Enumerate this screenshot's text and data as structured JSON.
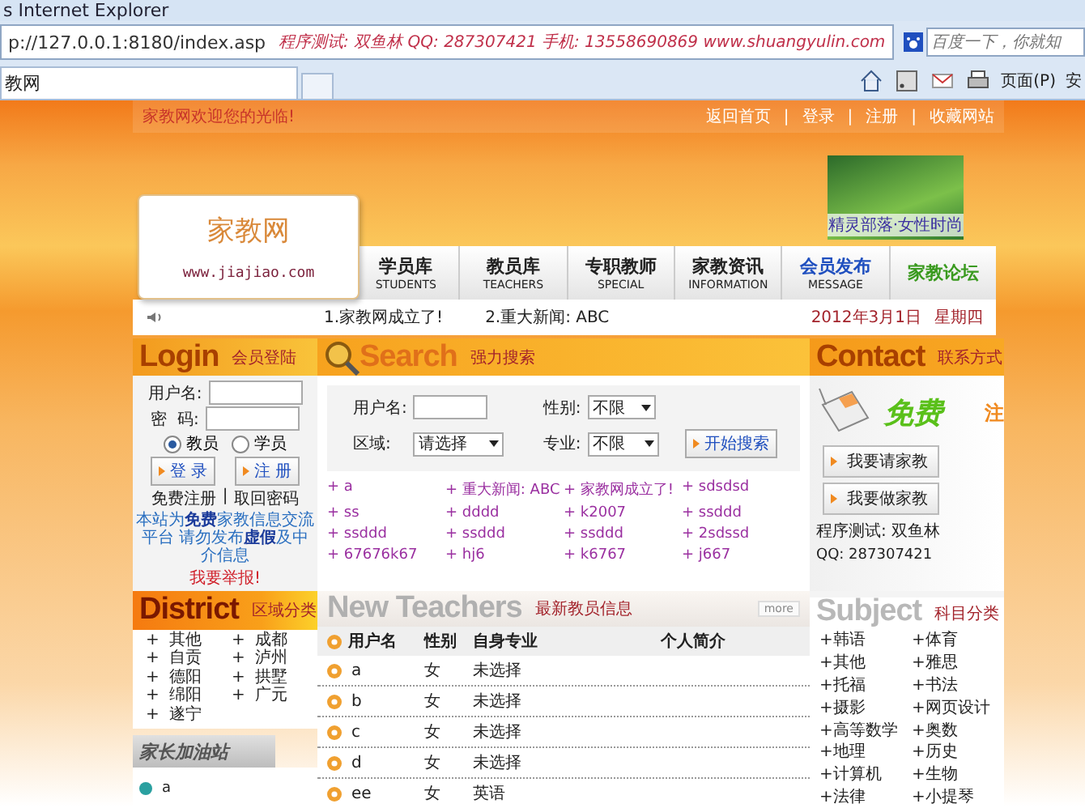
{
  "browser": {
    "title": "s Internet Explorer",
    "address": "p://127.0.0.1:8180/index.asp",
    "address_note": "程序测试: 双鱼林  QQ: 287307421  手机: 13558690869  www.shuangyulin.com",
    "search_placeholder": "百度一下，你就知",
    "tab_title": "教网",
    "page_menu": "页面(P)",
    "safety_menu": "安"
  },
  "top_bar": {
    "welcome": "家教网欢迎您的光临!",
    "links": [
      "返回首页",
      "登录",
      "注册",
      "收藏网站"
    ],
    "separator": "|"
  },
  "logo": {
    "name": "家教网",
    "url": "www.jiajiao.com"
  },
  "ad": {
    "caption": "精灵部落·女性时尚"
  },
  "nav": [
    {
      "label": "学员库",
      "sub": "STUDENTS",
      "color": "#222222"
    },
    {
      "label": "教员库",
      "sub": "TEACHERS",
      "color": "#222222"
    },
    {
      "label": "专职教师",
      "sub": "SPECIAL",
      "color": "#222222"
    },
    {
      "label": "家教资讯",
      "sub": "INFORMATION",
      "color": "#222222"
    },
    {
      "label": "会员发布",
      "sub": "MESSAGE",
      "color": "#1f4fbf"
    },
    {
      "label": "家教论坛",
      "color": "#3a9a1f"
    }
  ],
  "news": {
    "items": [
      "1.家教网成立了!",
      "2.重大新闻: ABC"
    ],
    "date": "2012年3月1日",
    "weekday": "星期四"
  },
  "login": {
    "title": "Login",
    "subtitle": "会员登陆",
    "username_label": "用户名:",
    "password_label": "密  码:",
    "roles": [
      {
        "label": "教员",
        "selected": true
      },
      {
        "label": "学员",
        "selected": false
      }
    ],
    "buttons": [
      "登 录",
      "注 册"
    ],
    "links": [
      "免费注册",
      "取回密码"
    ],
    "separator": "|",
    "notice": "本站为**免费**家教信息交流平台 请勿发布**虚假**及中介信息",
    "report": "我要举报!"
  },
  "search": {
    "title": "Search",
    "subtitle": "强力搜索",
    "username_label": "用户名:",
    "gender_label": "性别:",
    "gender_value": "不限",
    "area_label": "区域:",
    "area_value": "请选择",
    "major_label": "专业:",
    "major_value": "不限",
    "button": "开始搜索",
    "links": [
      "+ a",
      "+ 重大新闻: ABC",
      "+ 家教网成立了!",
      "+ sdsdsd",
      "+ ss",
      "+ dddd",
      "+ k2007",
      "+ ssddd",
      "+ ssddd",
      "+ ssddd",
      "+ ssddd",
      "+ 2sdssd",
      "+ 67676k67",
      "+ hj6",
      "+ k6767",
      "+ j667"
    ]
  },
  "contact": {
    "title": "Contact",
    "subtitle": "联系方式",
    "free": "免费",
    "register": "注",
    "buttons": [
      "我要请家教",
      "我要做家教"
    ],
    "tester": "程序测试: 双鱼林",
    "qq": "QQ: 287307421"
  },
  "district": {
    "title": "District",
    "subtitle": "区域分类",
    "items": [
      "+  其他",
      "+  成都",
      "+  自贡",
      "+  泸州",
      "+  德阳",
      "+  拱墅",
      "+  绵阳",
      "+  广元",
      "+  遂宁"
    ]
  },
  "parents": {
    "title": "家长加油站",
    "items": [
      "a"
    ]
  },
  "teachers": {
    "title": "New Teachers",
    "subtitle": "最新教员信息",
    "more": "more",
    "columns": [
      "用户名",
      "性别",
      "自身专业",
      "个人简介"
    ],
    "rows": [
      {
        "username": "a",
        "gender": "女",
        "major": "未选择"
      },
      {
        "username": "b",
        "gender": "女",
        "major": "未选择"
      },
      {
        "username": "c",
        "gender": "女",
        "major": "未选择"
      },
      {
        "username": "d",
        "gender": "女",
        "major": "未选择"
      },
      {
        "username": "ee",
        "gender": "女",
        "major": "英语"
      }
    ]
  },
  "subject": {
    "title": "Subject",
    "subtitle": "科目分类",
    "items": [
      "+韩语",
      "+体育",
      "+其他",
      "+雅思",
      "+托福",
      "+书法",
      "+摄影",
      "+网页设计",
      "+高等数学",
      "+奥数",
      "+地理",
      "+历史",
      "+计算机",
      "+生物",
      "+法律",
      "+小提琴"
    ]
  }
}
